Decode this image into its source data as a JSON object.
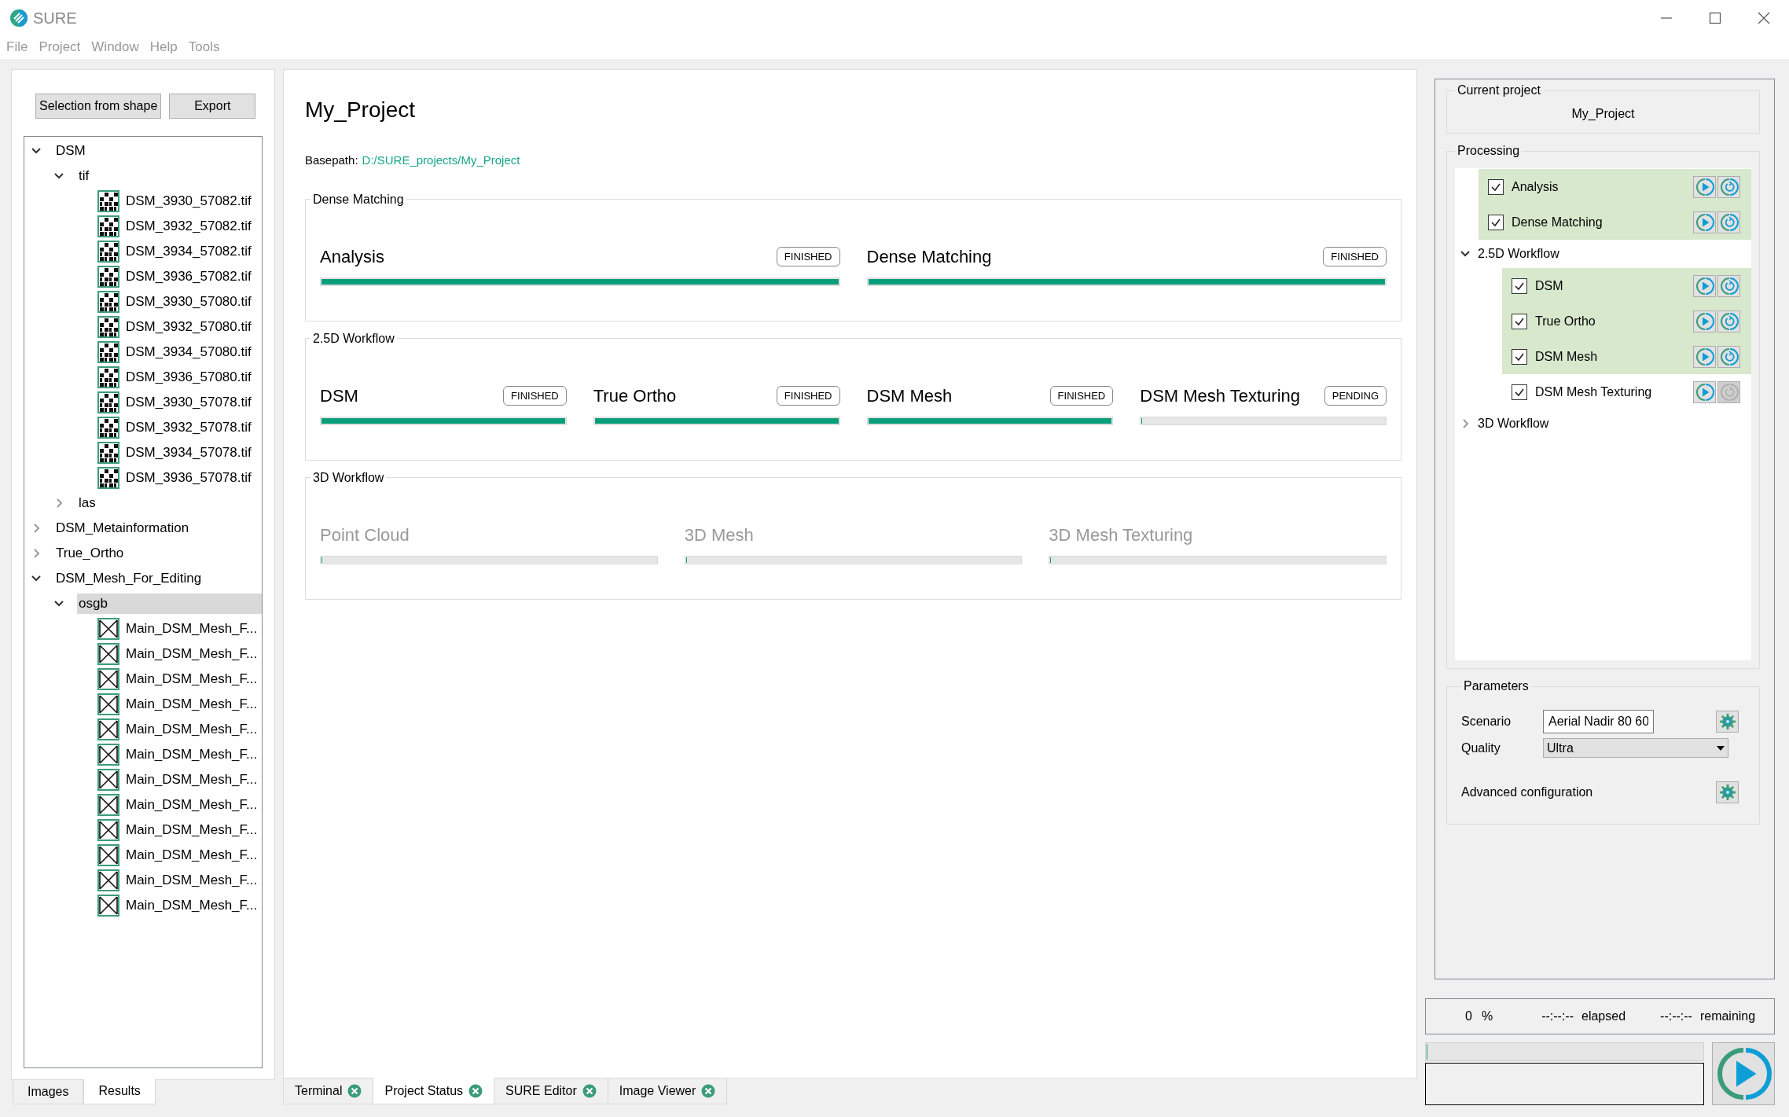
{
  "window": {
    "title": "SURE"
  },
  "menu": [
    "File",
    "Project",
    "Window",
    "Help",
    "Tools"
  ],
  "left_panel": {
    "buttons": [
      "Selection from shape",
      "Export"
    ],
    "tree": [
      {
        "kind": "folder",
        "label": "DSM",
        "expanded": true,
        "selected": false,
        "children": [
          {
            "kind": "folder",
            "label": "tif",
            "expanded": true,
            "selected": false,
            "children": [
              {
                "kind": "raster",
                "label": "DSM_3930_57082.tif",
                "selected": false
              },
              {
                "kind": "raster",
                "label": "DSM_3932_57082.tif",
                "selected": false
              },
              {
                "kind": "raster",
                "label": "DSM_3934_57082.tif",
                "selected": false
              },
              {
                "kind": "raster",
                "label": "DSM_3936_57082.tif",
                "selected": false
              },
              {
                "kind": "raster",
                "label": "DSM_3930_57080.tif",
                "selected": false
              },
              {
                "kind": "raster",
                "label": "DSM_3932_57080.tif",
                "selected": false
              },
              {
                "kind": "raster",
                "label": "DSM_3934_57080.tif",
                "selected": false
              },
              {
                "kind": "raster",
                "label": "DSM_3936_57080.tif",
                "selected": false
              },
              {
                "kind": "raster",
                "label": "DSM_3930_57078.tif",
                "selected": false
              },
              {
                "kind": "raster",
                "label": "DSM_3932_57078.tif",
                "selected": false
              },
              {
                "kind": "raster",
                "label": "DSM_3934_57078.tif",
                "selected": false
              },
              {
                "kind": "raster",
                "label": "DSM_3936_57078.tif",
                "selected": false
              }
            ]
          },
          {
            "kind": "folder",
            "label": "las",
            "expanded": false,
            "selected": false
          }
        ]
      },
      {
        "kind": "folder",
        "label": "DSM_Metainformation",
        "expanded": false,
        "selected": false
      },
      {
        "kind": "folder",
        "label": "True_Ortho",
        "expanded": false,
        "selected": false
      },
      {
        "kind": "folder",
        "label": "DSM_Mesh_For_Editing",
        "expanded": true,
        "selected": false,
        "children": [
          {
            "kind": "folder",
            "label": "osgb",
            "expanded": true,
            "selected": true,
            "children": [
              {
                "kind": "mesh",
                "label": "Main_DSM_Mesh_F...",
                "selected": false
              },
              {
                "kind": "mesh",
                "label": "Main_DSM_Mesh_F...",
                "selected": false
              },
              {
                "kind": "mesh",
                "label": "Main_DSM_Mesh_F...",
                "selected": false
              },
              {
                "kind": "mesh",
                "label": "Main_DSM_Mesh_F...",
                "selected": false
              },
              {
                "kind": "mesh",
                "label": "Main_DSM_Mesh_F...",
                "selected": false
              },
              {
                "kind": "mesh",
                "label": "Main_DSM_Mesh_F...",
                "selected": false
              },
              {
                "kind": "mesh",
                "label": "Main_DSM_Mesh_F...",
                "selected": false
              },
              {
                "kind": "mesh",
                "label": "Main_DSM_Mesh_F...",
                "selected": false
              },
              {
                "kind": "mesh",
                "label": "Main_DSM_Mesh_F...",
                "selected": false
              },
              {
                "kind": "mesh",
                "label": "Main_DSM_Mesh_F...",
                "selected": false
              },
              {
                "kind": "mesh",
                "label": "Main_DSM_Mesh_F...",
                "selected": false
              },
              {
                "kind": "mesh",
                "label": "Main_DSM_Mesh_F...",
                "selected": false
              }
            ]
          }
        ]
      }
    ],
    "tabs": [
      {
        "label": "Images",
        "selected": false
      },
      {
        "label": "Results",
        "selected": true
      }
    ]
  },
  "project": {
    "title": "My_Project",
    "basepath_label": "Basepath:",
    "basepath": "D:/SURE_projects/My_Project",
    "groups": [
      {
        "title": "Dense Matching",
        "stages": [
          {
            "name": "Analysis",
            "status": "FINISHED",
            "level": 1,
            "disabled": false
          },
          {
            "name": "Dense Matching",
            "status": "FINISHED",
            "level": 1,
            "disabled": false
          }
        ]
      },
      {
        "title": "2.5D Workflow",
        "stages": [
          {
            "name": "DSM",
            "status": "FINISHED",
            "level": 1,
            "disabled": false
          },
          {
            "name": "True Ortho",
            "status": "FINISHED",
            "level": 1,
            "disabled": false
          },
          {
            "name": "DSM Mesh",
            "status": "FINISHED",
            "level": 1,
            "disabled": false
          },
          {
            "name": "DSM Mesh Texturing",
            "status": "PENDING",
            "level": 0,
            "disabled": false
          }
        ]
      },
      {
        "title": "3D Workflow",
        "stages": [
          {
            "name": "Point Cloud",
            "level": 0,
            "disabled": true
          },
          {
            "name": "3D Mesh",
            "level": 0,
            "disabled": true
          },
          {
            "name": "3D Mesh Texturing",
            "level": 0,
            "disabled": true
          }
        ]
      }
    ]
  },
  "bottom_tabs": [
    {
      "label": "Terminal",
      "selected": false
    },
    {
      "label": "Project Status",
      "selected": true
    },
    {
      "label": "SURE Editor",
      "selected": false
    },
    {
      "label": "Image Viewer",
      "selected": false
    }
  ],
  "right_panel": {
    "current_project": {
      "title": "Current project",
      "value": "My_Project"
    },
    "processing": {
      "title": "Processing",
      "items": [
        {
          "kind": "step",
          "label": "Analysis",
          "checked": true,
          "done": true,
          "reset_enabled": true
        },
        {
          "kind": "step",
          "label": "Dense Matching",
          "checked": true,
          "done": true,
          "reset_enabled": true
        },
        {
          "kind": "group",
          "label": "2.5D Workflow",
          "expanded": true,
          "children": [
            {
              "kind": "step",
              "label": "DSM",
              "checked": true,
              "done": true,
              "reset_enabled": true
            },
            {
              "kind": "step",
              "label": "True Ortho",
              "checked": true,
              "done": true,
              "reset_enabled": true
            },
            {
              "kind": "step",
              "label": "DSM Mesh",
              "checked": true,
              "done": true,
              "reset_enabled": true
            },
            {
              "kind": "step",
              "label": "DSM Mesh Texturing",
              "checked": true,
              "done": false,
              "reset_enabled": false
            }
          ]
        },
        {
          "kind": "group",
          "label": "3D Workflow",
          "expanded": false
        }
      ]
    },
    "parameters": {
      "title": "Parameters",
      "scenario": {
        "label": "Scenario",
        "value": "Aerial Nadir 80 60"
      },
      "quality": {
        "label": "Quality",
        "value": "Ultra"
      },
      "advanced": {
        "label": "Advanced configuration"
      }
    }
  },
  "status": {
    "percent": "0",
    "percent_unit": "%",
    "elapsed_time": "--:--:--",
    "elapsed_label": "elapsed",
    "remaining_time": "--:--:--",
    "remaining_label": "remaining",
    "progress": {
      "level": 0
    }
  }
}
